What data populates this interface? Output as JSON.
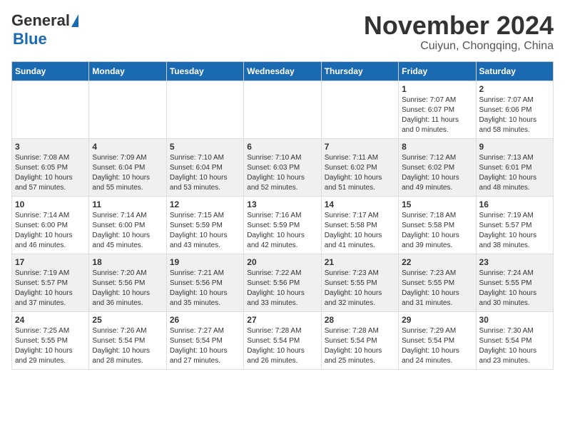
{
  "header": {
    "logo_general": "General",
    "logo_blue": "Blue",
    "month_title": "November 2024",
    "location": "Cuiyun, Chongqing, China"
  },
  "weekdays": [
    "Sunday",
    "Monday",
    "Tuesday",
    "Wednesday",
    "Thursday",
    "Friday",
    "Saturday"
  ],
  "weeks": [
    [
      {
        "day": "",
        "info": ""
      },
      {
        "day": "",
        "info": ""
      },
      {
        "day": "",
        "info": ""
      },
      {
        "day": "",
        "info": ""
      },
      {
        "day": "",
        "info": ""
      },
      {
        "day": "1",
        "info": "Sunrise: 7:07 AM\nSunset: 6:07 PM\nDaylight: 11 hours\nand 0 minutes."
      },
      {
        "day": "2",
        "info": "Sunrise: 7:07 AM\nSunset: 6:06 PM\nDaylight: 10 hours\nand 58 minutes."
      }
    ],
    [
      {
        "day": "3",
        "info": "Sunrise: 7:08 AM\nSunset: 6:05 PM\nDaylight: 10 hours\nand 57 minutes."
      },
      {
        "day": "4",
        "info": "Sunrise: 7:09 AM\nSunset: 6:04 PM\nDaylight: 10 hours\nand 55 minutes."
      },
      {
        "day": "5",
        "info": "Sunrise: 7:10 AM\nSunset: 6:04 PM\nDaylight: 10 hours\nand 53 minutes."
      },
      {
        "day": "6",
        "info": "Sunrise: 7:10 AM\nSunset: 6:03 PM\nDaylight: 10 hours\nand 52 minutes."
      },
      {
        "day": "7",
        "info": "Sunrise: 7:11 AM\nSunset: 6:02 PM\nDaylight: 10 hours\nand 51 minutes."
      },
      {
        "day": "8",
        "info": "Sunrise: 7:12 AM\nSunset: 6:02 PM\nDaylight: 10 hours\nand 49 minutes."
      },
      {
        "day": "9",
        "info": "Sunrise: 7:13 AM\nSunset: 6:01 PM\nDaylight: 10 hours\nand 48 minutes."
      }
    ],
    [
      {
        "day": "10",
        "info": "Sunrise: 7:14 AM\nSunset: 6:00 PM\nDaylight: 10 hours\nand 46 minutes."
      },
      {
        "day": "11",
        "info": "Sunrise: 7:14 AM\nSunset: 6:00 PM\nDaylight: 10 hours\nand 45 minutes."
      },
      {
        "day": "12",
        "info": "Sunrise: 7:15 AM\nSunset: 5:59 PM\nDaylight: 10 hours\nand 43 minutes."
      },
      {
        "day": "13",
        "info": "Sunrise: 7:16 AM\nSunset: 5:59 PM\nDaylight: 10 hours\nand 42 minutes."
      },
      {
        "day": "14",
        "info": "Sunrise: 7:17 AM\nSunset: 5:58 PM\nDaylight: 10 hours\nand 41 minutes."
      },
      {
        "day": "15",
        "info": "Sunrise: 7:18 AM\nSunset: 5:58 PM\nDaylight: 10 hours\nand 39 minutes."
      },
      {
        "day": "16",
        "info": "Sunrise: 7:19 AM\nSunset: 5:57 PM\nDaylight: 10 hours\nand 38 minutes."
      }
    ],
    [
      {
        "day": "17",
        "info": "Sunrise: 7:19 AM\nSunset: 5:57 PM\nDaylight: 10 hours\nand 37 minutes."
      },
      {
        "day": "18",
        "info": "Sunrise: 7:20 AM\nSunset: 5:56 PM\nDaylight: 10 hours\nand 36 minutes."
      },
      {
        "day": "19",
        "info": "Sunrise: 7:21 AM\nSunset: 5:56 PM\nDaylight: 10 hours\nand 35 minutes."
      },
      {
        "day": "20",
        "info": "Sunrise: 7:22 AM\nSunset: 5:56 PM\nDaylight: 10 hours\nand 33 minutes."
      },
      {
        "day": "21",
        "info": "Sunrise: 7:23 AM\nSunset: 5:55 PM\nDaylight: 10 hours\nand 32 minutes."
      },
      {
        "day": "22",
        "info": "Sunrise: 7:23 AM\nSunset: 5:55 PM\nDaylight: 10 hours\nand 31 minutes."
      },
      {
        "day": "23",
        "info": "Sunrise: 7:24 AM\nSunset: 5:55 PM\nDaylight: 10 hours\nand 30 minutes."
      }
    ],
    [
      {
        "day": "24",
        "info": "Sunrise: 7:25 AM\nSunset: 5:55 PM\nDaylight: 10 hours\nand 29 minutes."
      },
      {
        "day": "25",
        "info": "Sunrise: 7:26 AM\nSunset: 5:54 PM\nDaylight: 10 hours\nand 28 minutes."
      },
      {
        "day": "26",
        "info": "Sunrise: 7:27 AM\nSunset: 5:54 PM\nDaylight: 10 hours\nand 27 minutes."
      },
      {
        "day": "27",
        "info": "Sunrise: 7:28 AM\nSunset: 5:54 PM\nDaylight: 10 hours\nand 26 minutes."
      },
      {
        "day": "28",
        "info": "Sunrise: 7:28 AM\nSunset: 5:54 PM\nDaylight: 10 hours\nand 25 minutes."
      },
      {
        "day": "29",
        "info": "Sunrise: 7:29 AM\nSunset: 5:54 PM\nDaylight: 10 hours\nand 24 minutes."
      },
      {
        "day": "30",
        "info": "Sunrise: 7:30 AM\nSunset: 5:54 PM\nDaylight: 10 hours\nand 23 minutes."
      }
    ]
  ]
}
